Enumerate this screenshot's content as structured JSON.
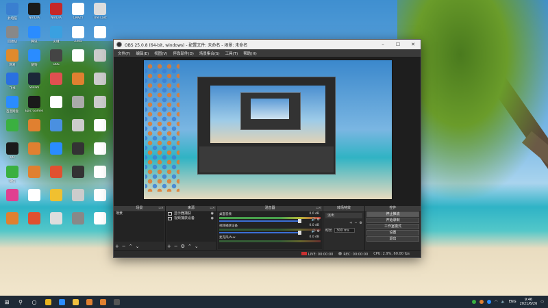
{
  "desktop": {
    "icons": [
      {
        "label": "此电脑",
        "color": "#3a7fd0"
      },
      {
        "label": "NVIDIA",
        "color": "#1a1a1a"
      },
      {
        "label": "NVIDIA",
        "color": "#c62828"
      },
      {
        "label": "CRAZY",
        "color": "#ffffff"
      },
      {
        "label": "The Last",
        "color": "#dddddd"
      },
      {
        "label": "回收站",
        "color": "#888888"
      },
      {
        "label": "腾讯",
        "color": "#2a8cff"
      },
      {
        "label": "火绒",
        "color": "#3aa0e0"
      },
      {
        "label": "2345",
        "color": "#ffffff"
      },
      {
        "label": "",
        "color": "#ffffff"
      },
      {
        "label": "网易",
        "color": "#e08a2c"
      },
      {
        "label": "酷狗",
        "color": "#2a8cff"
      },
      {
        "label": "OBS",
        "color": "#444444"
      },
      {
        "label": "",
        "color": "#ffffff"
      },
      {
        "label": "",
        "color": "#cccccc"
      },
      {
        "label": "飞书",
        "color": "#2a70e0"
      },
      {
        "label": "Steam",
        "color": "#1b2838"
      },
      {
        "label": "",
        "color": "#e05050"
      },
      {
        "label": "",
        "color": "#e08030"
      },
      {
        "label": "",
        "color": "#cccccc"
      },
      {
        "label": "百度网盘",
        "color": "#2a8cff"
      },
      {
        "label": "Epic Games",
        "color": "#1a1a1a"
      },
      {
        "label": "",
        "color": "#ffffff"
      },
      {
        "label": "",
        "color": "#aaaaaa"
      },
      {
        "label": "",
        "color": "#cccccc"
      },
      {
        "label": "",
        "color": "#3ab040"
      },
      {
        "label": "",
        "color": "#e08030"
      },
      {
        "label": "",
        "color": "#4a90e0"
      },
      {
        "label": "",
        "color": "#cccccc"
      },
      {
        "label": "",
        "color": "#ffffff"
      },
      {
        "label": "QQ",
        "color": "#1a1a1a"
      },
      {
        "label": "",
        "color": "#e08030"
      },
      {
        "label": "",
        "color": "#2a8cff"
      },
      {
        "label": "",
        "color": "#333333"
      },
      {
        "label": "",
        "color": "#ffffff"
      },
      {
        "label": "微信",
        "color": "#3ab040"
      },
      {
        "label": "",
        "color": "#e08030"
      },
      {
        "label": "",
        "color": "#e05030"
      },
      {
        "label": "",
        "color": "#333333"
      },
      {
        "label": "",
        "color": "#ffffff"
      },
      {
        "label": "",
        "color": "#e04090"
      },
      {
        "label": "",
        "color": "#ffffff"
      },
      {
        "label": "",
        "color": "#f0c030"
      },
      {
        "label": "",
        "color": "#cccccc"
      },
      {
        "label": "",
        "color": "#ffffff"
      },
      {
        "label": "",
        "color": "#e08030"
      },
      {
        "label": "",
        "color": "#e05030"
      },
      {
        "label": "",
        "color": "#dddddd"
      },
      {
        "label": "",
        "color": "#888888"
      },
      {
        "label": "",
        "color": "#ffffff"
      }
    ]
  },
  "obs": {
    "title": "OBS 25.0.8 (64-bit, windows) - 配置文件: 未命名 - 场景: 未命名",
    "menu": [
      "文件(F)",
      "编辑(E)",
      "视图(V)",
      "停靠部件(D)",
      "场景集合(S)",
      "工具(T)",
      "帮助(H)"
    ],
    "docks": {
      "scenes": {
        "title": "场景",
        "items": [
          "场景"
        ]
      },
      "sources": {
        "title": "来源",
        "items": [
          "显示器捕获",
          "视频捕获设备"
        ]
      },
      "mixer": {
        "title": "混音器",
        "channels": [
          {
            "name": "桌面音频",
            "db": "0.0 dB"
          },
          {
            "name": "视频捕获设备",
            "db": "0.0 dB"
          },
          {
            "name": "麦克风/Aux",
            "db": "0.0 dB"
          }
        ]
      },
      "transitions": {
        "title": "转场特效",
        "selected": "淡出",
        "duration_label": "时长",
        "duration_value": "300 ms"
      },
      "controls": {
        "title": "控件",
        "buttons": [
          "停止推流",
          "开始录制",
          "工作室模式",
          "设置",
          "退出"
        ]
      }
    },
    "status": {
      "live": "LIVE: 00:00:00",
      "rec": "REC: 00:00:00",
      "cpu": "CPU: 2.9%, 60.00 fps"
    }
  },
  "taskbar": {
    "start_icon": "windows-icon",
    "search_icon": "search-icon",
    "taskview_icon": "taskview-icon",
    "apps": [
      {
        "name": "chrome-icon",
        "color": "#e8b520"
      },
      {
        "name": "browser-icon",
        "color": "#2a8cff"
      },
      {
        "name": "explorer-icon",
        "color": "#f0c040"
      },
      {
        "name": "app-icon",
        "color": "#e08030"
      },
      {
        "name": "app-icon",
        "color": "#e08030"
      },
      {
        "name": "obs-icon",
        "color": "#555555"
      }
    ],
    "tray_lang": "ENG",
    "time": "9:46",
    "date": "2021/6/26"
  }
}
